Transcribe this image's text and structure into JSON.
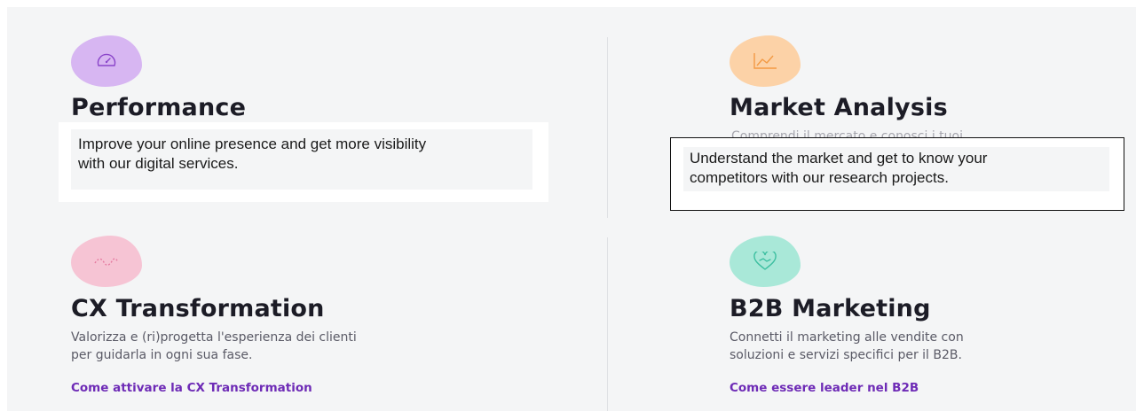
{
  "cards": {
    "performance": {
      "title": "Performance",
      "icon": "speedometer-icon",
      "icon_bg": "#d7b6f2",
      "icon_color": "#8a45c9"
    },
    "market": {
      "title": "Market Analysis",
      "icon": "line-chart-icon",
      "icon_bg": "#fcd2a7",
      "icon_color": "#f39a44",
      "partial_description": "Comprendi il mercato e conosci i tuoi"
    },
    "cx": {
      "title": "CX Transformation",
      "icon": "wave-line-icon",
      "icon_bg": "#f6c4d4",
      "icon_color": "#e57aa0",
      "description_line1": "Valorizza e (ri)progetta l'esperienza dei clienti",
      "description_line2": "per guidarla in ogni sua fase.",
      "link": "Come attivare la CX Transformation"
    },
    "b2b": {
      "title": "B2B Marketing",
      "icon": "heart-handshake-icon",
      "icon_bg": "#a9e8d8",
      "icon_color": "#3cbfa0",
      "description_line1": "Connetti il marketing alle vendite con",
      "description_line2": "soluzioni e servizi specifici per il B2B.",
      "link": "Come essere leader nel B2B"
    }
  },
  "overlays": {
    "performance_line1": "Improve your online presence and get more visibility",
    "performance_line2": "with our digital services.",
    "market_line1": "Understand the market and get to know your",
    "market_line2": "competitors with our research projects."
  },
  "colors": {
    "background": "#f4f5f6",
    "heading": "#1c1c26",
    "link": "#6e2bb6"
  }
}
